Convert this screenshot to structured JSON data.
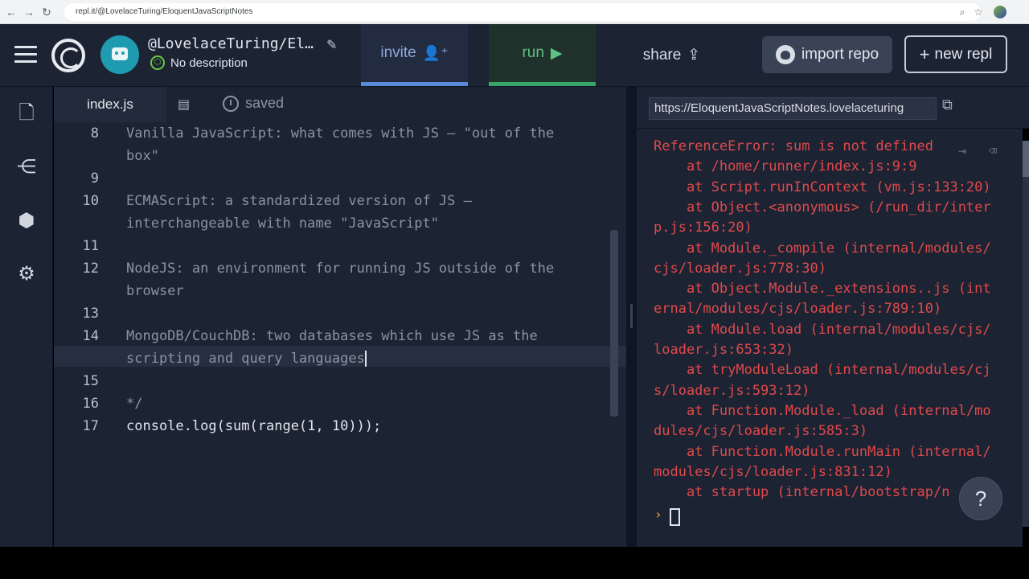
{
  "browser": {
    "url": "repl.it/@LovelaceTuring/EloquentJavaScriptNotes",
    "icons": [
      "back-icon",
      "forward-icon",
      "reload-icon",
      "zoom-icon",
      "star-icon",
      "profile-icon"
    ]
  },
  "header": {
    "owner": "@LovelaceTuring/El…",
    "description": "No description",
    "invite_label": "invite",
    "run_label": "run",
    "share_label": "share",
    "import_label": "import repo",
    "new_repl_label": "new repl"
  },
  "sidebar": {
    "icons": [
      "files-icon",
      "version-control-icon",
      "packages-icon",
      "settings-icon"
    ]
  },
  "editor": {
    "file_tab": "index.js",
    "saved_label": "saved",
    "lines": [
      {
        "n": "8",
        "text": "Vanilla JavaScript: what comes with JS – \"out of the"
      },
      {
        "n": "",
        "text": "box\""
      },
      {
        "n": "9",
        "text": ""
      },
      {
        "n": "10",
        "text": "ECMAScript: a standardized version of JS –"
      },
      {
        "n": "",
        "text": "interchangeable with name \"JavaScript\""
      },
      {
        "n": "11",
        "text": ""
      },
      {
        "n": "12",
        "text": "NodeJS: an environment for running JS outside of the"
      },
      {
        "n": "",
        "text": "browser"
      },
      {
        "n": "13",
        "text": ""
      },
      {
        "n": "14",
        "text": "MongoDB/CouchDB: two databases which use JS as the"
      },
      {
        "n": "",
        "text": "scripting and query languages"
      },
      {
        "n": "15",
        "text": ""
      },
      {
        "n": "16",
        "text": "*/"
      },
      {
        "n": "17",
        "text": "console.log(sum(range(1, 10)));"
      }
    ]
  },
  "webview": {
    "url": "https://EloquentJavaScriptNotes.lovelaceturing"
  },
  "console": {
    "lines": [
      "ReferenceError: sum is not defined",
      "    at /home/runner/index.js:9:9",
      "    at Script.runInContext (vm.js:133:20)",
      "    at Object.<anonymous> (/run_dir/inter",
      "p.js:156:20)",
      "    at Module._compile (internal/modules/",
      "cjs/loader.js:778:30)",
      "    at Object.Module._extensions..js (int",
      "ernal/modules/cjs/loader.js:789:10)",
      "    at Module.load (internal/modules/cjs/",
      "loader.js:653:32)",
      "    at tryModuleLoad (internal/modules/cj",
      "s/loader.js:593:12)",
      "    at Function.Module._load (internal/mo",
      "dules/cjs/loader.js:585:3)",
      "    at Function.Module.runMain (internal/",
      "modules/cjs/loader.js:831:12)",
      "    at startup (internal/bootstrap/n"
    ],
    "prompt": "›",
    "help_label": "?"
  }
}
